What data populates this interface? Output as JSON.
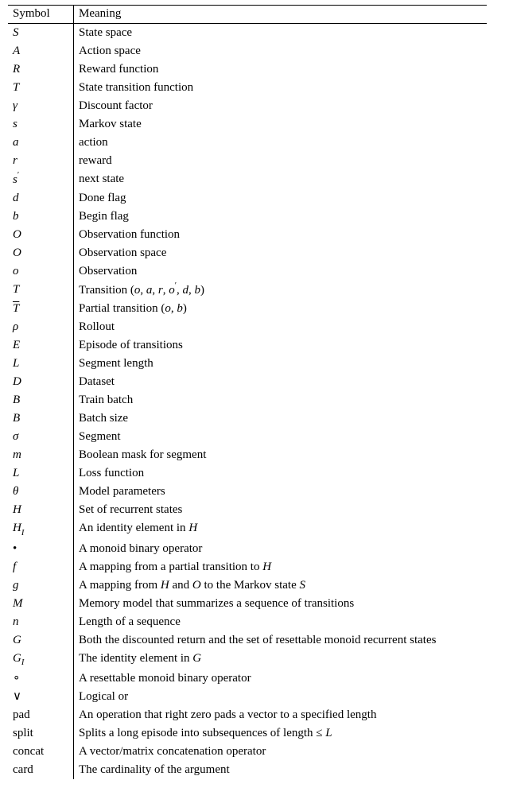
{
  "chart_data": {
    "type": "table",
    "columns": [
      "Symbol",
      "Meaning"
    ],
    "rows": [
      [
        "S",
        "State space"
      ],
      [
        "A",
        "Action space"
      ],
      [
        "R",
        "Reward function"
      ],
      [
        "T (caligraphic)",
        "State transition function"
      ],
      [
        "gamma",
        "Discount factor"
      ],
      [
        "s",
        "Markov state"
      ],
      [
        "a",
        "action"
      ],
      [
        "r",
        "reward"
      ],
      [
        "s prime",
        "next state"
      ],
      [
        "d",
        "Done flag"
      ],
      [
        "b",
        "Begin flag"
      ],
      [
        "O (caligraphic)",
        "Observation function"
      ],
      [
        "O",
        "Observation space"
      ],
      [
        "o",
        "Observation"
      ],
      [
        "T",
        "Transition (o, a, r, o', d, b)"
      ],
      [
        "T bar",
        "Partial transition (o, b)"
      ],
      [
        "rho",
        "Rollout"
      ],
      [
        "E",
        "Episode of transitions"
      ],
      [
        "L",
        "Segment length"
      ],
      [
        "D (caligraphic)",
        "Dataset"
      ],
      [
        "B (caligraphic)",
        "Train batch"
      ],
      [
        "B",
        "Batch size"
      ],
      [
        "sigma",
        "Segment"
      ],
      [
        "m",
        "Boolean mask for segment"
      ],
      [
        "L (caligraphic)",
        "Loss function"
      ],
      [
        "theta",
        "Model parameters"
      ],
      [
        "H",
        "Set of recurrent states"
      ],
      [
        "H_I",
        "An identity element in H"
      ],
      [
        "bullet",
        "A monoid binary operator"
      ],
      [
        "f",
        "A mapping from a partial transition to H"
      ],
      [
        "g",
        "A mapping from H and O to the Markov state S"
      ],
      [
        "M",
        "Memory model that summarizes a sequence of transitions"
      ],
      [
        "n",
        "Length of a sequence"
      ],
      [
        "G",
        "Both the discounted return and the set of resettable monoid recurrent states"
      ],
      [
        "G_I",
        "The identity element in G"
      ],
      [
        "circ",
        "A resettable monoid binary operator"
      ],
      [
        "vee",
        "Logical or"
      ],
      [
        "pad",
        "An operation that right zero pads a vector to a specified length"
      ],
      [
        "split",
        "Splits a long episode into subsequences of length <= L"
      ],
      [
        "concat",
        "A vector/matrix concatenation operator"
      ],
      [
        "card",
        "The cardinality of the argument"
      ]
    ]
  },
  "header": {
    "symbol": "Symbol",
    "meaning": "Meaning"
  },
  "rows": [
    {
      "sym_html": "<span class='sym'>S</span>",
      "meaning": "State space"
    },
    {
      "sym_html": "<span class='sym'>A</span>",
      "meaning": "Action space"
    },
    {
      "sym_html": "<span class='sym'>R</span>",
      "meaning": "Reward function"
    },
    {
      "sym_html": "<span class='cal'>T</span>",
      "meaning": "State transition function"
    },
    {
      "sym_html": "<span class='sym'>&gamma;</span>",
      "meaning": "Discount factor"
    },
    {
      "sym_html": "<span class='sym'>s</span>",
      "meaning": "Markov state"
    },
    {
      "sym_html": "<span class='sym'>a</span>",
      "meaning": "action"
    },
    {
      "sym_html": "<span class='sym'>r</span>",
      "meaning": "reward"
    },
    {
      "sym_html": "<span class='sym'>s</span><span class='sup'>&prime;</span>",
      "meaning": "next state"
    },
    {
      "sym_html": "<span class='sym'>d</span>",
      "meaning": "Done flag"
    },
    {
      "sym_html": "<span class='sym'>b</span>",
      "meaning": "Begin flag"
    },
    {
      "sym_html": "<span class='cal'>O</span>",
      "meaning": "Observation function"
    },
    {
      "sym_html": "<span class='sym'>O</span>",
      "meaning": "Observation space"
    },
    {
      "sym_html": "<span class='sym'>o</span>",
      "meaning": "Observation"
    },
    {
      "sym_html": "<span class='sym'>T</span>",
      "meaning_html": "Transition <span class='roman'>(</span><span class='sym'>o</span>, <span class='sym'>a</span>, <span class='sym'>r</span>, <span class='sym'>o</span><span class='sup'>&prime;</span>, <span class='sym'>d</span>, <span class='sym'>b</span><span class='roman'>)</span>"
    },
    {
      "sym_html": "<span class='sym overline'>T</span>",
      "meaning_html": "Partial transition <span class='roman'>(</span><span class='sym'>o</span>, <span class='sym'>b</span><span class='roman'>)</span>"
    },
    {
      "sym_html": "<span class='sym'>&rho;</span>",
      "meaning": "Rollout"
    },
    {
      "sym_html": "<span class='sym'>E</span>",
      "meaning": "Episode of transitions"
    },
    {
      "sym_html": "<span class='sym'>L</span>",
      "meaning": "Segment length"
    },
    {
      "sym_html": "<span class='cal'>D</span>",
      "meaning": "Dataset"
    },
    {
      "sym_html": "<span class='cal'>B</span>",
      "meaning": "Train batch"
    },
    {
      "sym_html": "<span class='sym'>B</span>",
      "meaning": "Batch size"
    },
    {
      "sym_html": "<span class='sym'>&sigma;</span>",
      "meaning": "Segment"
    },
    {
      "sym_html": "<span class='sym'>m</span>",
      "meaning": "Boolean mask for segment"
    },
    {
      "sym_html": "<span class='cal'>L</span>",
      "meaning": "Loss function"
    },
    {
      "sym_html": "<span class='sym'>&theta;</span>",
      "meaning": "Model parameters"
    },
    {
      "sym_html": "<span class='sym'>H</span>",
      "meaning": "Set of recurrent states"
    },
    {
      "sym_html": "<span class='sym'>H</span><span class='sub sym'>I</span>",
      "meaning_html": "An identity element in <span class='sym'>H</span>"
    },
    {
      "sym_html": "<span class='roman'>&bull;</span>",
      "meaning": "A monoid binary operator"
    },
    {
      "sym_html": "<span class='sym'>f</span>",
      "meaning_html": "A mapping from a partial transition to <span class='sym'>H</span>"
    },
    {
      "sym_html": "<span class='sym'>g</span>",
      "meaning_html": "A mapping from <span class='sym'>H</span> and <span class='sym'>O</span> to the Markov state <span class='sym'>S</span>"
    },
    {
      "sym_html": "<span class='sym'>M</span>",
      "meaning": "Memory model that summarizes a sequence of transitions"
    },
    {
      "sym_html": "<span class='sym'>n</span>",
      "meaning": "Length of a sequence"
    },
    {
      "sym_html": "<span class='sym'>G</span>",
      "meaning": "Both the discounted return and the set of resettable monoid recurrent states"
    },
    {
      "sym_html": "<span class='sym'>G</span><span class='sub sym'>I</span>",
      "meaning_html": "The identity element in <span class='sym'>G</span>"
    },
    {
      "sym_html": "<span class='roman'>&#8728;</span>",
      "meaning": "A resettable monoid binary operator"
    },
    {
      "sym_html": "<span class='roman'>&or;</span>",
      "meaning": "Logical or"
    },
    {
      "sym_html": "<span class='roman'>pad</span>",
      "meaning": "An operation that right zero pads a vector to a specified length"
    },
    {
      "sym_html": "<span class='roman'>split</span>",
      "meaning_html": "Splits a long episode into subsequences of length &le; <span class='sym'>L</span>"
    },
    {
      "sym_html": "<span class='roman'>concat</span>",
      "meaning": "A vector/matrix concatenation operator"
    },
    {
      "sym_html": "<span class='roman'>card</span>",
      "meaning": "The cardinality of the argument"
    }
  ]
}
